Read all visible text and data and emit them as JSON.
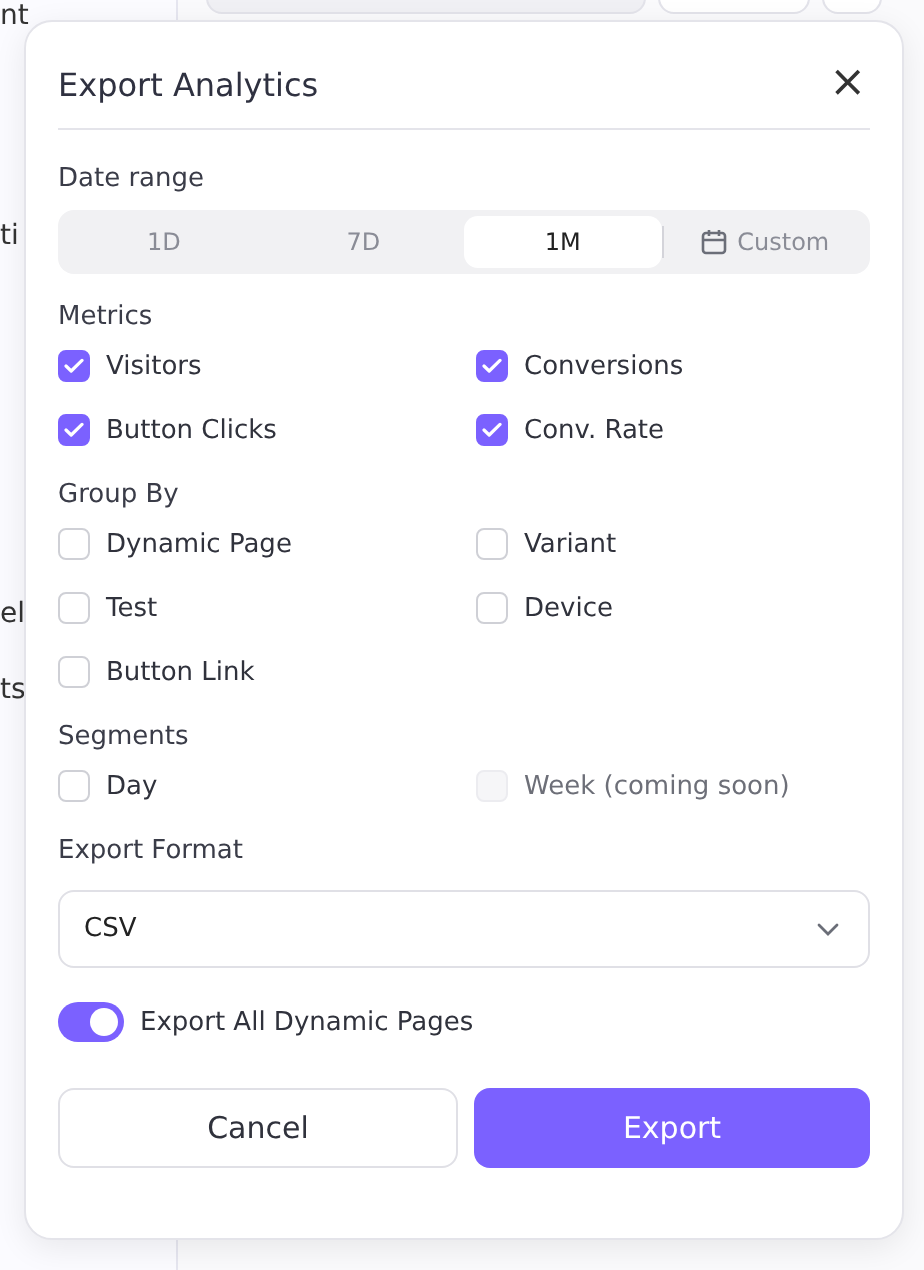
{
  "background": {
    "sidebar_fragments": [
      "nt",
      "ti",
      "el",
      "ts"
    ]
  },
  "dialog": {
    "title": "Export Analytics",
    "close": "×",
    "date_range": {
      "label": "Date range",
      "tabs": [
        {
          "label": "1D",
          "kind": "preset",
          "selected": false
        },
        {
          "label": "7D",
          "kind": "preset",
          "selected": false
        },
        {
          "label": "1M",
          "kind": "preset",
          "selected": true
        },
        {
          "label": "Custom",
          "kind": "custom",
          "selected": false
        }
      ]
    },
    "metrics": {
      "label": "Metrics",
      "items": [
        {
          "label": "Visitors",
          "checked": true
        },
        {
          "label": "Conversions",
          "checked": true
        },
        {
          "label": "Button Clicks",
          "checked": true
        },
        {
          "label": "Conv. Rate",
          "checked": true
        }
      ]
    },
    "group_by": {
      "label": "Group By",
      "items": [
        {
          "label": "Dynamic Page",
          "checked": false
        },
        {
          "label": "Variant",
          "checked": false
        },
        {
          "label": "Test",
          "checked": false
        },
        {
          "label": "Device",
          "checked": false
        },
        {
          "label": "Button Link",
          "checked": false
        }
      ]
    },
    "segments": {
      "label": "Segments",
      "items": [
        {
          "label": "Day",
          "checked": false,
          "disabled": false
        },
        {
          "label": "Week (coming soon)",
          "checked": false,
          "disabled": true
        }
      ]
    },
    "export_format": {
      "label": "Export Format",
      "value": "CSV"
    },
    "toggle": {
      "label": "Export All Dynamic Pages",
      "on": true
    },
    "buttons": {
      "cancel": "Cancel",
      "export": "Export"
    }
  }
}
